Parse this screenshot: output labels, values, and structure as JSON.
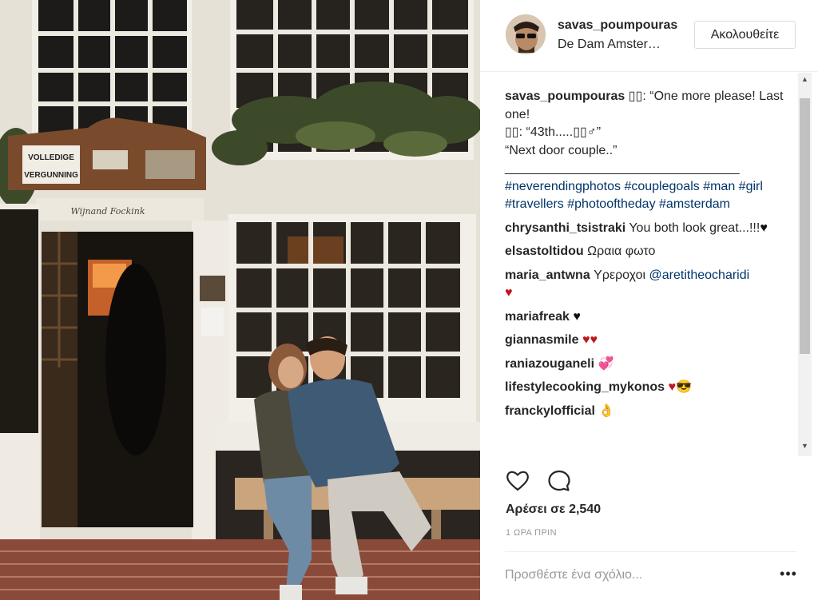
{
  "post": {
    "username": "savas_poumpouras",
    "location": "De Dam Amster…",
    "follow_label": "Ακολουθείτε",
    "photo_sign_top": "VOLLEDIGE",
    "photo_sign_bottom": "VERGUNNING",
    "photo_sign_script": "Wijnand Fockink"
  },
  "caption": {
    "user": "savas_poumpouras",
    "line1": "▯▯: “One more please! Last one!",
    "line2": "▯▯: “43th.....▯▯♂”",
    "line3": "“Next door couple..”",
    "line4": "_________________________________",
    "hashtags": "#neverendingphotos #couplegoals #man #girl #travellers #photooftheday #amsterdam"
  },
  "comments": [
    {
      "user": "chrysanthi_tsistraki",
      "text": "You both look great...!!!",
      "emoji": "♥",
      "emoji_color": "#111111"
    },
    {
      "user": "elsastoltidou",
      "text": "Ωραια φωτο",
      "emoji": "",
      "emoji_color": ""
    },
    {
      "user": "maria_antwna",
      "text": "Υρεροχοι",
      "mention": "@aretitheocharidi",
      "emoji": "♥",
      "emoji_color": "#c2141b"
    },
    {
      "user": "mariafreak",
      "text": "",
      "emoji": "♥",
      "emoji_color": "#111111"
    },
    {
      "user": "giannasmile",
      "text": "",
      "emoji": "♥♥",
      "emoji_color": "#c2141b"
    },
    {
      "user": "raniazouganeli",
      "text": "",
      "emoji": "💞",
      "emoji_color": "#c2141b"
    },
    {
      "user": "lifestylecooking_mykonos",
      "text": "",
      "emoji": "♥😎",
      "emoji_color": "#c2141b"
    },
    {
      "user": "franckylofficial",
      "text": "",
      "emoji": "👌",
      "emoji_color": "#e8b98f"
    }
  ],
  "actions": {
    "like_icon": "heart-outline-icon",
    "comment_icon": "speech-bubble-icon",
    "likes_text": "Αρέσει σε 2,540",
    "time_text": "1 ΩΡΑ ΠΡΙΝ",
    "comment_placeholder": "Προσθέστε ένα σχόλιο...",
    "more_label": "•••"
  },
  "colors": {
    "hashtag": "#003569",
    "text": "#262626",
    "muted": "#999999",
    "heart_red": "#c2141b"
  }
}
